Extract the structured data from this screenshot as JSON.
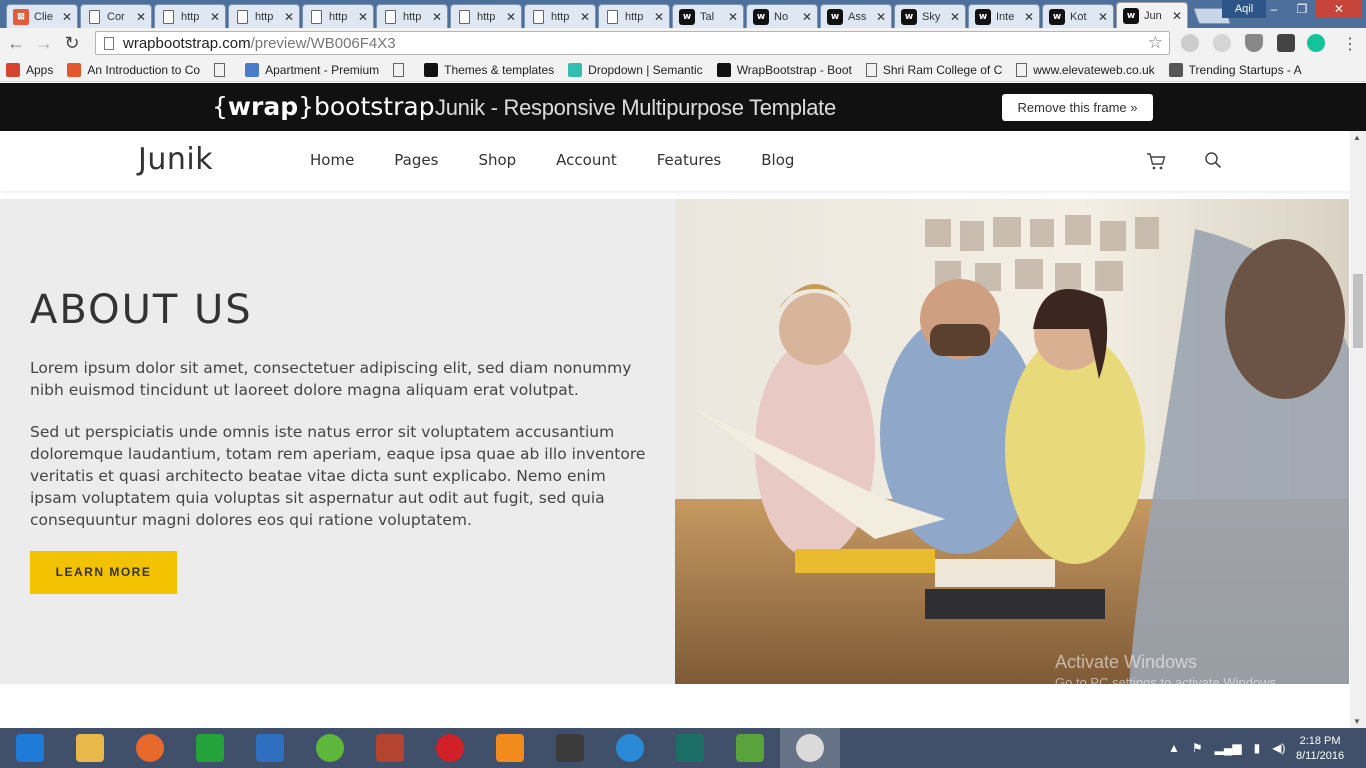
{
  "browser": {
    "tabs": [
      {
        "title": "Clie",
        "icon": "orange-square-icon"
      },
      {
        "title": "Cor",
        "icon": "page-icon"
      },
      {
        "title": "http",
        "icon": "page-icon"
      },
      {
        "title": "http",
        "icon": "page-icon"
      },
      {
        "title": "http",
        "icon": "page-icon"
      },
      {
        "title": "http",
        "icon": "page-icon"
      },
      {
        "title": "http",
        "icon": "page-icon"
      },
      {
        "title": "http",
        "icon": "page-icon"
      },
      {
        "title": "http",
        "icon": "page-icon"
      },
      {
        "title": "Tal",
        "icon": "wrap-icon"
      },
      {
        "title": "No",
        "icon": "wrap-icon"
      },
      {
        "title": "Ass",
        "icon": "wrap-icon"
      },
      {
        "title": "Sky",
        "icon": "wrap-icon"
      },
      {
        "title": "Inte",
        "icon": "wrap-icon"
      },
      {
        "title": "Kot",
        "icon": "wrap-icon"
      },
      {
        "title": "Jun",
        "icon": "wrap-icon",
        "active": true
      }
    ],
    "profile_name": "Aqil",
    "url_host": "wrapbootstrap.com",
    "url_path": "/preview/WB006F4X3",
    "bookmarks": [
      {
        "label": "Apps",
        "icon": "apps-grid-icon"
      },
      {
        "label": "An Introduction to Co",
        "icon": "plus-red-icon"
      },
      {
        "label": "",
        "icon": "page-icon"
      },
      {
        "label": "Apartment - Premium",
        "icon": "house-icon"
      },
      {
        "label": "",
        "icon": "page-icon"
      },
      {
        "label": "Themes & templates",
        "icon": "wrap-icon"
      },
      {
        "label": "Dropdown | Semantic",
        "icon": "semantic-s-icon"
      },
      {
        "label": "WrapBootstrap - Boot",
        "icon": "wrap-icon"
      },
      {
        "label": "Shri Ram College of C",
        "icon": "page-icon"
      },
      {
        "label": "www.elevateweb.co.uk",
        "icon": "page-icon"
      },
      {
        "label": "Trending Startups - A",
        "icon": "hand-icon"
      }
    ]
  },
  "frame": {
    "logo_brace_open": "{",
    "logo_wrap": "wrap",
    "logo_brace_close": "}",
    "logo_rest": "bootstrap",
    "title": "Junik - Responsive Multipurpose Template",
    "remove_button": "Remove this frame »"
  },
  "site": {
    "brand": "Junik",
    "menu": [
      "Home",
      "Pages",
      "Shop",
      "Account",
      "Features",
      "Blog"
    ],
    "about": {
      "heading": "ABOUT US",
      "paragraph1": "Lorem ipsum dolor sit amet, consectetuer adipiscing elit, sed diam nonummy nibh euismod tincidunt ut laoreet dolore magna aliquam erat volutpat.",
      "paragraph2": "Sed ut perspiciatis unde omnis iste natus error sit voluptatem accusantium doloremque laudantium, totam rem aperiam, eaque ipsa quae ab illo inventore veritatis et quasi architecto beatae vitae dicta sunt explicabo. Nemo enim ipsam voluptatem quia voluptas sit aspernatur aut odit aut fugit, sed quia consequuntur magni dolores eos qui ratione voluptatem.",
      "button": "LEARN MORE"
    },
    "accent": "#f2c200"
  },
  "watermark": {
    "line1": "Activate Windows",
    "line2": "Go to PC settings to activate Windows."
  },
  "taskbar": {
    "apps": [
      "windows-start-icon",
      "file-explorer-icon",
      "firefox-icon",
      "store-icon",
      "email-icon",
      "frog-app-icon",
      "paint-icon",
      "opera-icon",
      "vlc-icon",
      "sublime-icon",
      "ie-icon",
      "terminal-icon",
      "bluestacks-icon",
      "chrome-icon"
    ],
    "time": "2:18 PM",
    "date": "8/11/2016"
  }
}
